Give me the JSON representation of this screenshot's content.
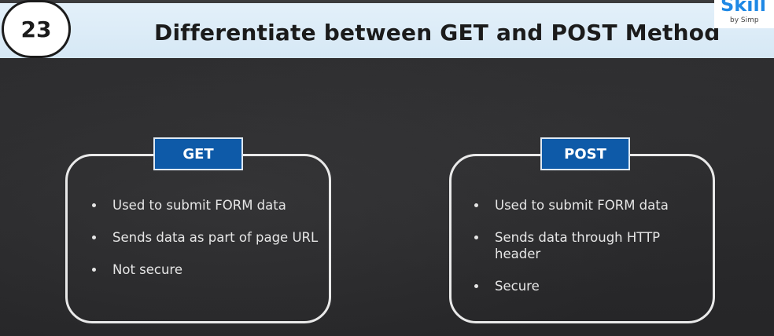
{
  "header": {
    "question_number": "23",
    "title": "Differentiate between GET and POST Method"
  },
  "logo": {
    "text": "Skill",
    "subtext": "by Simp"
  },
  "cards": [
    {
      "label": "GET",
      "items": [
        "Used to submit FORM data",
        "Sends data as part of page URL",
        "Not secure"
      ]
    },
    {
      "label": "POST",
      "items": [
        "Used to submit FORM data",
        "Sends data through HTTP header",
        "Secure"
      ]
    }
  ],
  "colors": {
    "header_bg": "#dbeaf6",
    "label_bg": "#0e5aa8",
    "card_border": "#e9e9e9",
    "logo": "#1e88e5"
  }
}
